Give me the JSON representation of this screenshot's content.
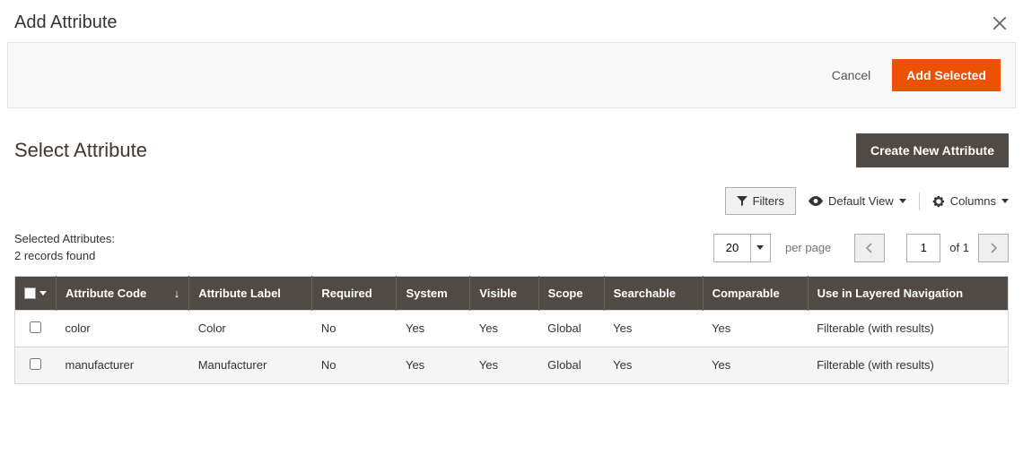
{
  "modal": {
    "title": "Add Attribute",
    "cancel": "Cancel",
    "addSelected": "Add Selected"
  },
  "section": {
    "title": "Select Attribute",
    "createNew": "Create New Attribute"
  },
  "toolbar": {
    "filters": "Filters",
    "defaultView": "Default View",
    "columns": "Columns"
  },
  "status": {
    "selected": "Selected Attributes:",
    "records": "2 records found"
  },
  "pager": {
    "pageSize": "20",
    "perPage": "per page",
    "currentPage": "1",
    "of": "of",
    "totalPages": "1"
  },
  "columns": [
    "Attribute Code",
    "Attribute Label",
    "Required",
    "System",
    "Visible",
    "Scope",
    "Searchable",
    "Comparable",
    "Use in Layered Navigation"
  ],
  "rows": [
    {
      "code": "color",
      "label": "Color",
      "required": "No",
      "system": "Yes",
      "visible": "Yes",
      "scope": "Global",
      "searchable": "Yes",
      "comparable": "Yes",
      "layered": "Filterable (with results)"
    },
    {
      "code": "manufacturer",
      "label": "Manufacturer",
      "required": "No",
      "system": "Yes",
      "visible": "Yes",
      "scope": "Global",
      "searchable": "Yes",
      "comparable": "Yes",
      "layered": "Filterable (with results)"
    }
  ]
}
